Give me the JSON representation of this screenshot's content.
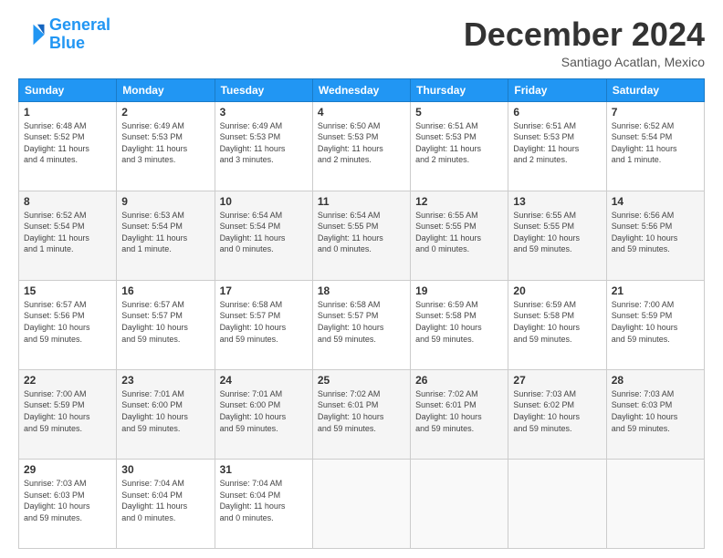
{
  "logo": {
    "line1": "General",
    "line2": "Blue"
  },
  "header": {
    "month": "December 2024",
    "location": "Santiago Acatlan, Mexico"
  },
  "days_of_week": [
    "Sunday",
    "Monday",
    "Tuesday",
    "Wednesday",
    "Thursday",
    "Friday",
    "Saturday"
  ],
  "weeks": [
    [
      {
        "num": "1",
        "info": "Sunrise: 6:48 AM\nSunset: 5:52 PM\nDaylight: 11 hours\nand 4 minutes."
      },
      {
        "num": "2",
        "info": "Sunrise: 6:49 AM\nSunset: 5:53 PM\nDaylight: 11 hours\nand 3 minutes."
      },
      {
        "num": "3",
        "info": "Sunrise: 6:49 AM\nSunset: 5:53 PM\nDaylight: 11 hours\nand 3 minutes."
      },
      {
        "num": "4",
        "info": "Sunrise: 6:50 AM\nSunset: 5:53 PM\nDaylight: 11 hours\nand 2 minutes."
      },
      {
        "num": "5",
        "info": "Sunrise: 6:51 AM\nSunset: 5:53 PM\nDaylight: 11 hours\nand 2 minutes."
      },
      {
        "num": "6",
        "info": "Sunrise: 6:51 AM\nSunset: 5:53 PM\nDaylight: 11 hours\nand 2 minutes."
      },
      {
        "num": "7",
        "info": "Sunrise: 6:52 AM\nSunset: 5:54 PM\nDaylight: 11 hours\nand 1 minute."
      }
    ],
    [
      {
        "num": "8",
        "info": "Sunrise: 6:52 AM\nSunset: 5:54 PM\nDaylight: 11 hours\nand 1 minute."
      },
      {
        "num": "9",
        "info": "Sunrise: 6:53 AM\nSunset: 5:54 PM\nDaylight: 11 hours\nand 1 minute."
      },
      {
        "num": "10",
        "info": "Sunrise: 6:54 AM\nSunset: 5:54 PM\nDaylight: 11 hours\nand 0 minutes."
      },
      {
        "num": "11",
        "info": "Sunrise: 6:54 AM\nSunset: 5:55 PM\nDaylight: 11 hours\nand 0 minutes."
      },
      {
        "num": "12",
        "info": "Sunrise: 6:55 AM\nSunset: 5:55 PM\nDaylight: 11 hours\nand 0 minutes."
      },
      {
        "num": "13",
        "info": "Sunrise: 6:55 AM\nSunset: 5:55 PM\nDaylight: 10 hours\nand 59 minutes."
      },
      {
        "num": "14",
        "info": "Sunrise: 6:56 AM\nSunset: 5:56 PM\nDaylight: 10 hours\nand 59 minutes."
      }
    ],
    [
      {
        "num": "15",
        "info": "Sunrise: 6:57 AM\nSunset: 5:56 PM\nDaylight: 10 hours\nand 59 minutes."
      },
      {
        "num": "16",
        "info": "Sunrise: 6:57 AM\nSunset: 5:57 PM\nDaylight: 10 hours\nand 59 minutes."
      },
      {
        "num": "17",
        "info": "Sunrise: 6:58 AM\nSunset: 5:57 PM\nDaylight: 10 hours\nand 59 minutes."
      },
      {
        "num": "18",
        "info": "Sunrise: 6:58 AM\nSunset: 5:57 PM\nDaylight: 10 hours\nand 59 minutes."
      },
      {
        "num": "19",
        "info": "Sunrise: 6:59 AM\nSunset: 5:58 PM\nDaylight: 10 hours\nand 59 minutes."
      },
      {
        "num": "20",
        "info": "Sunrise: 6:59 AM\nSunset: 5:58 PM\nDaylight: 10 hours\nand 59 minutes."
      },
      {
        "num": "21",
        "info": "Sunrise: 7:00 AM\nSunset: 5:59 PM\nDaylight: 10 hours\nand 59 minutes."
      }
    ],
    [
      {
        "num": "22",
        "info": "Sunrise: 7:00 AM\nSunset: 5:59 PM\nDaylight: 10 hours\nand 59 minutes."
      },
      {
        "num": "23",
        "info": "Sunrise: 7:01 AM\nSunset: 6:00 PM\nDaylight: 10 hours\nand 59 minutes."
      },
      {
        "num": "24",
        "info": "Sunrise: 7:01 AM\nSunset: 6:00 PM\nDaylight: 10 hours\nand 59 minutes."
      },
      {
        "num": "25",
        "info": "Sunrise: 7:02 AM\nSunset: 6:01 PM\nDaylight: 10 hours\nand 59 minutes."
      },
      {
        "num": "26",
        "info": "Sunrise: 7:02 AM\nSunset: 6:01 PM\nDaylight: 10 hours\nand 59 minutes."
      },
      {
        "num": "27",
        "info": "Sunrise: 7:03 AM\nSunset: 6:02 PM\nDaylight: 10 hours\nand 59 minutes."
      },
      {
        "num": "28",
        "info": "Sunrise: 7:03 AM\nSunset: 6:03 PM\nDaylight: 10 hours\nand 59 minutes."
      }
    ],
    [
      {
        "num": "29",
        "info": "Sunrise: 7:03 AM\nSunset: 6:03 PM\nDaylight: 10 hours\nand 59 minutes."
      },
      {
        "num": "30",
        "info": "Sunrise: 7:04 AM\nSunset: 6:04 PM\nDaylight: 11 hours\nand 0 minutes."
      },
      {
        "num": "31",
        "info": "Sunrise: 7:04 AM\nSunset: 6:04 PM\nDaylight: 11 hours\nand 0 minutes."
      },
      {
        "num": "",
        "info": ""
      },
      {
        "num": "",
        "info": ""
      },
      {
        "num": "",
        "info": ""
      },
      {
        "num": "",
        "info": ""
      }
    ]
  ]
}
